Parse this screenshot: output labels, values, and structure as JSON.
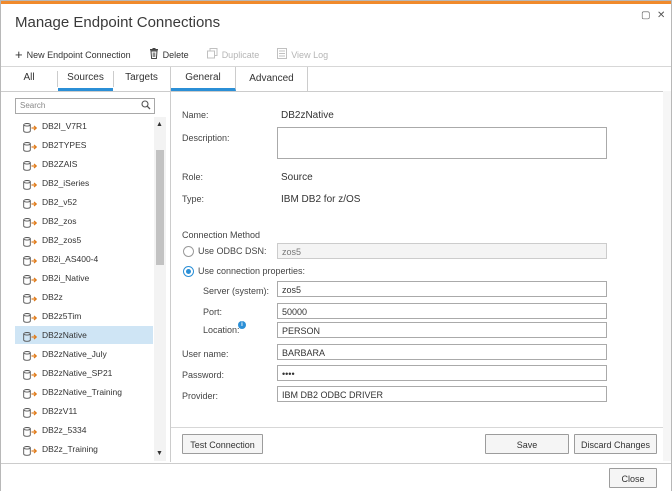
{
  "window": {
    "title": "Manage Endpoint Connections",
    "controls": {
      "restore": "▢",
      "close": "✕"
    }
  },
  "toolbar": {
    "new_label": "New Endpoint Connection",
    "delete_label": "Delete",
    "duplicate_label": "Duplicate",
    "viewlog_label": "View Log"
  },
  "left_tabs": [
    "All",
    "Sources",
    "Targets"
  ],
  "search": {
    "placeholder": "Search"
  },
  "endpoints": [
    "DB2I_V7R1",
    "DB2TYPES",
    "DB2ZAIS",
    "DB2_iSeries",
    "DB2_v52",
    "DB2_zos",
    "DB2_zos5",
    "DB2i_AS400-4",
    "DB2i_Native",
    "DB2z",
    "DB2z5Tim",
    "DB2zNative",
    "DB2zNative_July",
    "DB2zNative_SP21",
    "DB2zNative_Training",
    "DB2zV11",
    "DB2z_5334",
    "DB2z_Training"
  ],
  "selected_endpoint": "DB2zNative",
  "right_tabs": [
    "General",
    "Advanced"
  ],
  "form": {
    "name_label": "Name:",
    "name_value": "DB2zNative",
    "description_label": "Description:",
    "description_value": "",
    "role_label": "Role:",
    "role_value": "Source",
    "type_label": "Type:",
    "type_value": "IBM DB2 for z/OS",
    "connection_method_label": "Connection Method",
    "odbc_dsn_label": "Use ODBC DSN:",
    "odbc_dsn_value": "zos5",
    "conn_props_label": "Use connection properties:",
    "server_label": "Server (system):",
    "server_value": "zos5",
    "port_label": "Port:",
    "port_value": "50000",
    "location_label": "Location:",
    "location_value": "PERSON",
    "username_label": "User name:",
    "username_value": "BARBARA",
    "password_label": "Password:",
    "password_value": "••••",
    "provider_label": "Provider:",
    "provider_value": "IBM DB2 ODBC DRIVER"
  },
  "buttons": {
    "test": "Test Connection",
    "save": "Save",
    "discard": "Discard Changes",
    "close": "Close"
  },
  "colors": {
    "accent": "#2b8fd6",
    "topbar": "#f08a2c",
    "selection": "#cfe5f5",
    "db_icon": "#e07b1a"
  }
}
